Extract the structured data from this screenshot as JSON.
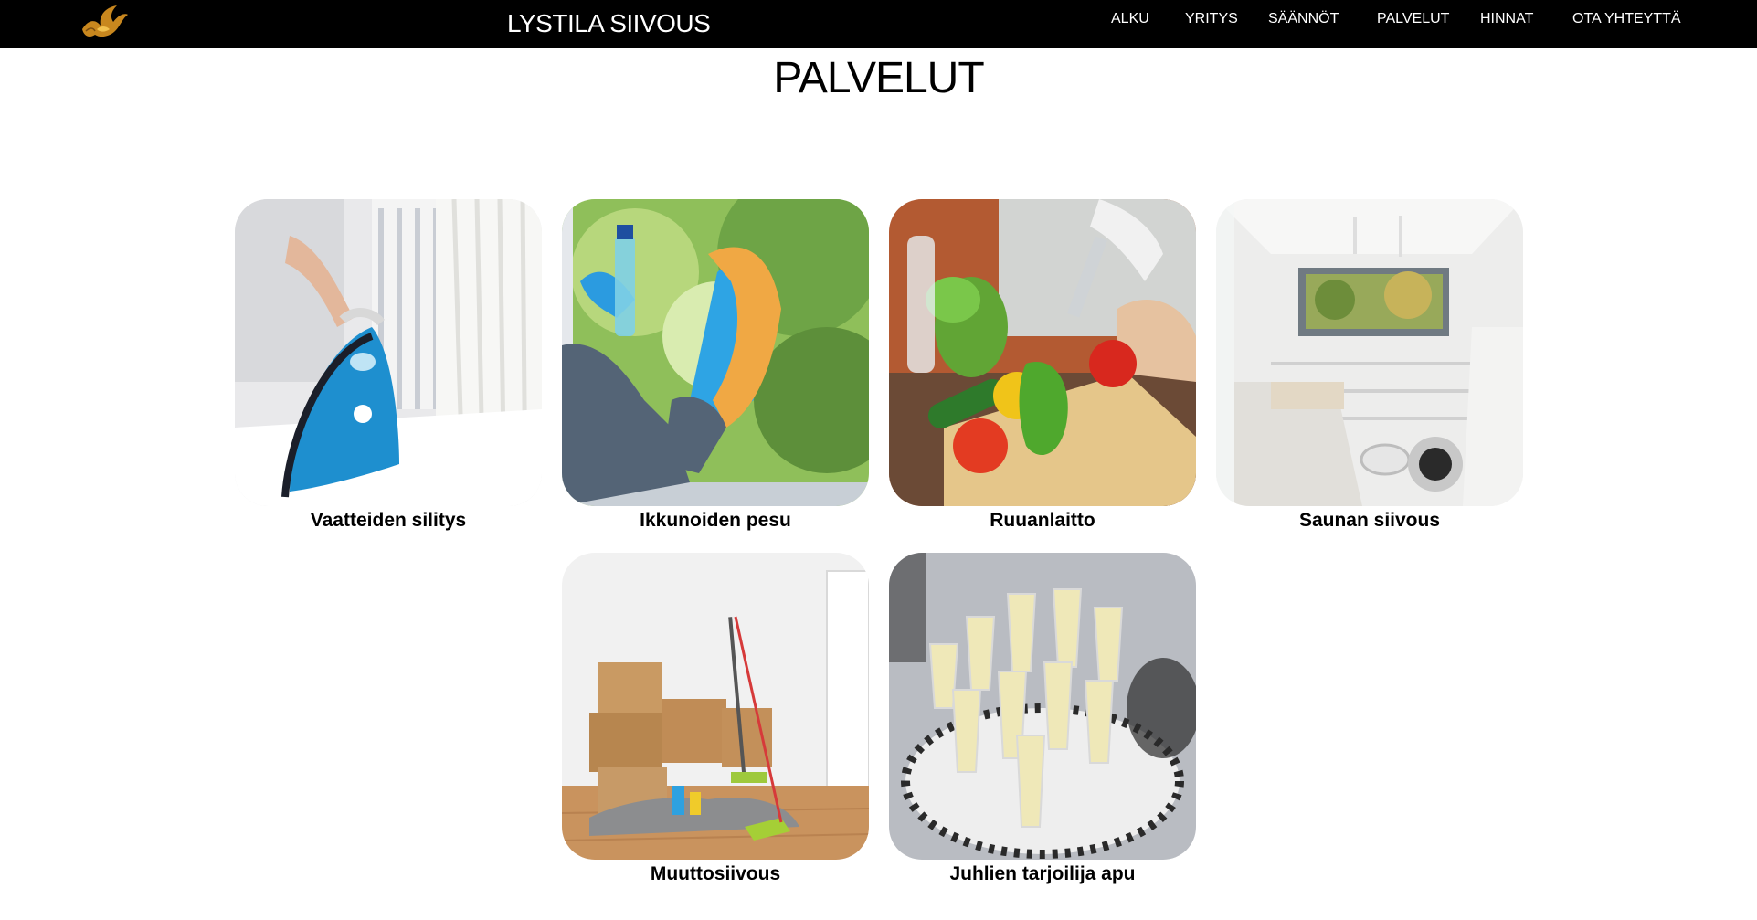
{
  "header": {
    "site_title": "LYSTILA SIIVOUS",
    "logo_icon": "golden-bird-logo-icon",
    "nav": [
      {
        "label": "ALKU"
      },
      {
        "label": "YRITYS"
      },
      {
        "label": "SÄÄNNÖT"
      },
      {
        "label": "PALVELUT"
      },
      {
        "label": "HINNAT"
      },
      {
        "label": "OTA YHTEYTTÄ"
      }
    ]
  },
  "main": {
    "heading": "PALVELUT",
    "services": [
      {
        "caption": "Vaatteiden silitys",
        "image": "ironing-photo"
      },
      {
        "caption": "Ikkunoiden pesu",
        "image": "window-washing-photo"
      },
      {
        "caption": "Ruuanlaitto",
        "image": "cooking-vegetables-photo"
      },
      {
        "caption": "Saunan siivous",
        "image": "sauna-room-photo"
      },
      {
        "caption": "Muuttosiivous",
        "image": "moving-boxes-photo"
      },
      {
        "caption": "Juhlien tarjoilija apu",
        "image": "champagne-glasses-photo"
      }
    ]
  },
  "colors": {
    "navbar_bg": "#000000",
    "nav_text": "#ffffff",
    "logo_gold": "#c8871e",
    "page_bg": "#ffffff"
  }
}
